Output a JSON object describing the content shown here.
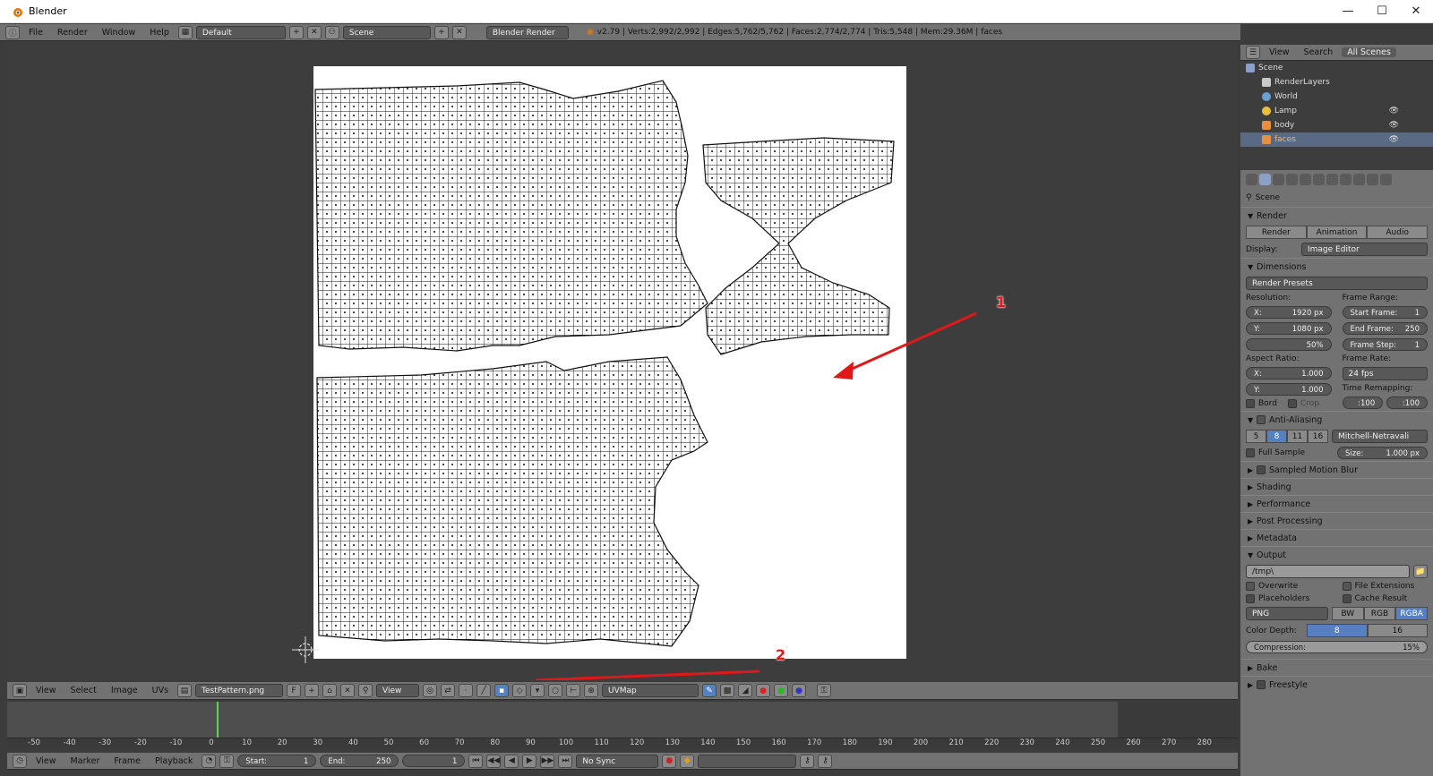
{
  "window": {
    "title": "Blender",
    "controls": [
      "—",
      "☐",
      "✕"
    ]
  },
  "info_header": {
    "menus": [
      "File",
      "Render",
      "Window",
      "Help"
    ],
    "screen_layout": "Default",
    "scene": "Scene",
    "render_engine": "Blender Render",
    "stats": "v2.79 | Verts:2,992/2,992 | Edges:5,762/5,762 | Faces:2,774/2,774 | Tris:5,548 | Mem:29.36M | faces"
  },
  "outliner": {
    "header": {
      "view": "View",
      "search": "Search",
      "filter": "All Scenes"
    },
    "items": [
      {
        "label": "Scene",
        "depth": 0,
        "selected": false
      },
      {
        "label": "RenderLayers",
        "depth": 1,
        "selected": false
      },
      {
        "label": "World",
        "depth": 1,
        "selected": false
      },
      {
        "label": "Lamp",
        "depth": 1,
        "selected": false
      },
      {
        "label": "body",
        "depth": 1,
        "selected": false
      },
      {
        "label": "faces",
        "depth": 1,
        "selected": true
      }
    ]
  },
  "properties": {
    "context": "Scene",
    "render": {
      "title": "Render",
      "buttons": [
        "Render",
        "Animation",
        "Audio"
      ],
      "display_label": "Display:",
      "display_value": "Image Editor"
    },
    "dimensions": {
      "title": "Dimensions",
      "presets": "Render Presets",
      "resolution_label": "Resolution:",
      "res_x": "X:",
      "res_x_val": "1920 px",
      "res_y": "Y:",
      "res_y_val": "1080 px",
      "res_pct": "50%",
      "frame_range_label": "Frame Range:",
      "start_frame": "Start Frame:",
      "start_frame_val": "1",
      "end_frame": "End Frame:",
      "end_frame_val": "250",
      "frame_step": "Frame Step:",
      "frame_step_val": "1",
      "aspect_label": "Aspect Ratio:",
      "asp_x": "X:",
      "asp_x_val": "1.000",
      "asp_y": "Y:",
      "asp_y_val": "1.000",
      "frame_rate_label": "Frame Rate:",
      "frame_rate": "24 fps",
      "time_remap_label": "Time Remapping:",
      "remap_old": ":100",
      "remap_new": ":100",
      "bord": "Bord",
      "crop": "Crop"
    },
    "anti_aliasing": {
      "title": "Anti-Aliasing",
      "samples": [
        "5",
        "8",
        "11",
        "16"
      ],
      "active_sample": "8",
      "filter": "Mitchell-Netravali",
      "full_sample": "Full Sample",
      "size_label": "Size:",
      "size_val": "1.000 px"
    },
    "collapsed": [
      "Sampled Motion Blur",
      "Shading",
      "Performance",
      "Post Processing",
      "Metadata"
    ],
    "output": {
      "title": "Output",
      "path": "/tmp\\",
      "overwrite": "Overwrite",
      "file_extensions": "File Extensions",
      "placeholders": "Placeholders",
      "cache_result": "Cache Result",
      "format": "PNG",
      "color_modes": [
        "BW",
        "RGB",
        "RGBA"
      ],
      "active_mode": "RGBA",
      "color_depth_label": "Color Depth:",
      "depths": [
        "8",
        "16"
      ],
      "compression_label": "Compression:",
      "compression_val": "15%"
    },
    "bottom": [
      "Bake",
      "Freestyle"
    ]
  },
  "image_editor_header": {
    "menus": [
      "View",
      "Select",
      "Image",
      "UVs"
    ],
    "image_name": "TestPattern.png",
    "fake_user": "F",
    "view_mode": "View",
    "uv_map": "UVMap"
  },
  "annotations": {
    "arrow1": "1",
    "arrow2": "2",
    "color": "#e01818"
  },
  "timeline": {
    "ticks": [
      "-50",
      "-40",
      "-30",
      "-20",
      "-10",
      "0",
      "10",
      "20",
      "30",
      "40",
      "50",
      "60",
      "70",
      "80",
      "90",
      "100",
      "110",
      "120",
      "130",
      "140",
      "150",
      "160",
      "170",
      "180",
      "190",
      "200",
      "210",
      "220",
      "230",
      "240",
      "250",
      "260",
      "270",
      "280"
    ],
    "menus": [
      "View",
      "Marker",
      "Frame",
      "Playback"
    ],
    "start_label": "Start:",
    "start_val": "1",
    "end_label": "End:",
    "end_val": "250",
    "current": "1",
    "sync": "No Sync"
  }
}
